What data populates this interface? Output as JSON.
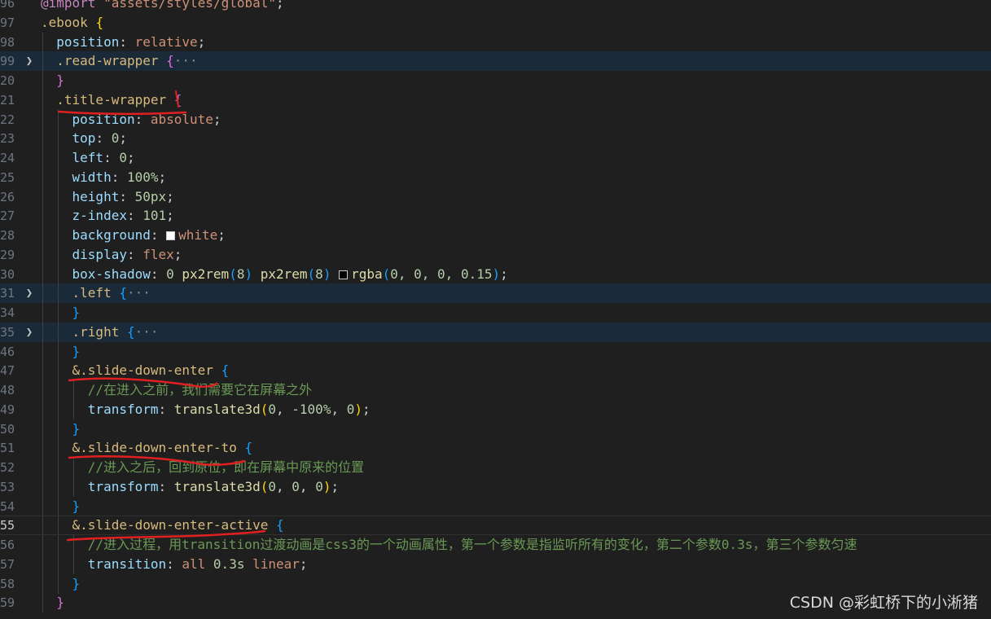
{
  "colors": {
    "background": "#1f1f1f",
    "selector": "#d7ba7d",
    "property": "#9cdcfe",
    "value": "#ce9178",
    "number": "#b5cea8",
    "function": "#dcdcaa",
    "comment": "#6a9955",
    "annotation_underline": "#e02020"
  },
  "lines": [
    {
      "num": "96",
      "fold": "",
      "tokens": [
        {
          "t": "@import",
          "c": "kw"
        },
        {
          "t": " \"assets/styles/global\"",
          "c": "str"
        },
        {
          "t": ";",
          "c": "punc"
        }
      ]
    },
    {
      "num": "97",
      "fold": "",
      "tokens": [
        {
          "t": ".ebook ",
          "c": "sel"
        },
        {
          "t": "{",
          "c": "brace1"
        }
      ]
    },
    {
      "num": "98",
      "fold": "",
      "tokens": [
        {
          "t": "  position",
          "c": "prop"
        },
        {
          "t": ": ",
          "c": "punc"
        },
        {
          "t": "relative",
          "c": "val"
        },
        {
          "t": ";",
          "c": "punc"
        }
      ]
    },
    {
      "num": "99",
      "fold": ">",
      "tokens": [
        {
          "t": "  .read-wrapper ",
          "c": "sel"
        },
        {
          "t": "{",
          "c": "brace2"
        },
        {
          "t": "···",
          "c": "ellipsis"
        }
      ]
    },
    {
      "num": "20",
      "fold": "",
      "tokens": [
        {
          "t": "  ",
          "c": "punc"
        },
        {
          "t": "}",
          "c": "brace2"
        }
      ]
    },
    {
      "num": "21",
      "fold": "",
      "tokens": [
        {
          "t": "  .title-wrapper ",
          "c": "sel"
        },
        {
          "t": "{",
          "c": "brace2"
        }
      ]
    },
    {
      "num": "22",
      "fold": "",
      "tokens": [
        {
          "t": "    position",
          "c": "prop"
        },
        {
          "t": ": ",
          "c": "punc"
        },
        {
          "t": "absolute",
          "c": "val"
        },
        {
          "t": ";",
          "c": "punc"
        }
      ]
    },
    {
      "num": "23",
      "fold": "",
      "tokens": [
        {
          "t": "    top",
          "c": "prop"
        },
        {
          "t": ": ",
          "c": "punc"
        },
        {
          "t": "0",
          "c": "num"
        },
        {
          "t": ";",
          "c": "punc"
        }
      ]
    },
    {
      "num": "24",
      "fold": "",
      "tokens": [
        {
          "t": "    left",
          "c": "prop"
        },
        {
          "t": ": ",
          "c": "punc"
        },
        {
          "t": "0",
          "c": "num"
        },
        {
          "t": ";",
          "c": "punc"
        }
      ]
    },
    {
      "num": "25",
      "fold": "",
      "tokens": [
        {
          "t": "    width",
          "c": "prop"
        },
        {
          "t": ": ",
          "c": "punc"
        },
        {
          "t": "100%",
          "c": "num"
        },
        {
          "t": ";",
          "c": "punc"
        }
      ]
    },
    {
      "num": "26",
      "fold": "",
      "tokens": [
        {
          "t": "    height",
          "c": "prop"
        },
        {
          "t": ": ",
          "c": "punc"
        },
        {
          "t": "50px",
          "c": "num"
        },
        {
          "t": ";",
          "c": "punc"
        }
      ]
    },
    {
      "num": "27",
      "fold": "",
      "tokens": [
        {
          "t": "    z-index",
          "c": "prop"
        },
        {
          "t": ": ",
          "c": "punc"
        },
        {
          "t": "101",
          "c": "num"
        },
        {
          "t": ";",
          "c": "punc"
        }
      ]
    },
    {
      "num": "28",
      "fold": "",
      "tokens": [
        {
          "t": "    background",
          "c": "prop"
        },
        {
          "t": ": ",
          "c": "punc"
        },
        {
          "t": "",
          "c": "swatch-white"
        },
        {
          "t": "white",
          "c": "val"
        },
        {
          "t": ";",
          "c": "punc"
        }
      ]
    },
    {
      "num": "29",
      "fold": "",
      "tokens": [
        {
          "t": "    display",
          "c": "prop"
        },
        {
          "t": ": ",
          "c": "punc"
        },
        {
          "t": "flex",
          "c": "val"
        },
        {
          "t": ";",
          "c": "punc"
        }
      ]
    },
    {
      "num": "30",
      "fold": "",
      "tokens": [
        {
          "t": "    box-shadow",
          "c": "prop"
        },
        {
          "t": ": ",
          "c": "punc"
        },
        {
          "t": "0 ",
          "c": "num"
        },
        {
          "t": "px2rem",
          "c": "fn"
        },
        {
          "t": "(",
          "c": "brace3"
        },
        {
          "t": "8",
          "c": "num"
        },
        {
          "t": ") ",
          "c": "brace3"
        },
        {
          "t": "px2rem",
          "c": "fn"
        },
        {
          "t": "(",
          "c": "brace3"
        },
        {
          "t": "8",
          "c": "num"
        },
        {
          "t": ") ",
          "c": "brace3"
        },
        {
          "t": "",
          "c": "swatch-dark"
        },
        {
          "t": "rgba",
          "c": "fn"
        },
        {
          "t": "(",
          "c": "brace3"
        },
        {
          "t": "0, 0, 0, 0.15",
          "c": "num"
        },
        {
          "t": ")",
          "c": "brace3"
        },
        {
          "t": ";",
          "c": "punc"
        }
      ]
    },
    {
      "num": "31",
      "fold": ">",
      "tokens": [
        {
          "t": "    .left ",
          "c": "sel"
        },
        {
          "t": "{",
          "c": "brace3"
        },
        {
          "t": "···",
          "c": "ellipsis"
        }
      ]
    },
    {
      "num": "34",
      "fold": "",
      "tokens": [
        {
          "t": "    ",
          "c": "punc"
        },
        {
          "t": "}",
          "c": "brace3"
        }
      ]
    },
    {
      "num": "35",
      "fold": ">",
      "tokens": [
        {
          "t": "    .right ",
          "c": "sel"
        },
        {
          "t": "{",
          "c": "brace3"
        },
        {
          "t": "···",
          "c": "ellipsis"
        }
      ]
    },
    {
      "num": "46",
      "fold": "",
      "tokens": [
        {
          "t": "    ",
          "c": "punc"
        },
        {
          "t": "}",
          "c": "brace3"
        }
      ]
    },
    {
      "num": "47",
      "fold": "",
      "tokens": [
        {
          "t": "    &.slide-down-enter ",
          "c": "sel"
        },
        {
          "t": "{",
          "c": "brace3"
        }
      ]
    },
    {
      "num": "48",
      "fold": "",
      "tokens": [
        {
          "t": "      //在进入之前，我们需要它在屏幕之外",
          "c": "cmt"
        }
      ]
    },
    {
      "num": "49",
      "fold": "",
      "tokens": [
        {
          "t": "      transform",
          "c": "prop"
        },
        {
          "t": ": ",
          "c": "punc"
        },
        {
          "t": "translate3d",
          "c": "fn"
        },
        {
          "t": "(",
          "c": "brace1"
        },
        {
          "t": "0",
          "c": "num"
        },
        {
          "t": ", ",
          "c": "punc"
        },
        {
          "t": "-100%",
          "c": "num"
        },
        {
          "t": ", ",
          "c": "punc"
        },
        {
          "t": "0",
          "c": "num"
        },
        {
          "t": ")",
          "c": "brace1"
        },
        {
          "t": ";",
          "c": "punc"
        }
      ]
    },
    {
      "num": "50",
      "fold": "",
      "tokens": [
        {
          "t": "    ",
          "c": "punc"
        },
        {
          "t": "}",
          "c": "brace3"
        }
      ]
    },
    {
      "num": "51",
      "fold": "",
      "tokens": [
        {
          "t": "    &.slide-down-enter-to ",
          "c": "sel"
        },
        {
          "t": "{",
          "c": "brace3"
        }
      ]
    },
    {
      "num": "52",
      "fold": "",
      "tokens": [
        {
          "t": "      //进入之后，回到原位，即在屏幕中原来的位置",
          "c": "cmt"
        }
      ]
    },
    {
      "num": "53",
      "fold": "",
      "tokens": [
        {
          "t": "      transform",
          "c": "prop"
        },
        {
          "t": ": ",
          "c": "punc"
        },
        {
          "t": "translate3d",
          "c": "fn"
        },
        {
          "t": "(",
          "c": "brace1"
        },
        {
          "t": "0",
          "c": "num"
        },
        {
          "t": ", ",
          "c": "punc"
        },
        {
          "t": "0",
          "c": "num"
        },
        {
          "t": ", ",
          "c": "punc"
        },
        {
          "t": "0",
          "c": "num"
        },
        {
          "t": ")",
          "c": "brace1"
        },
        {
          "t": ";",
          "c": "punc"
        }
      ]
    },
    {
      "num": "54",
      "fold": "",
      "tokens": [
        {
          "t": "    ",
          "c": "punc"
        },
        {
          "t": "}",
          "c": "brace3"
        }
      ]
    },
    {
      "num": "55",
      "fold": "",
      "tokens": [
        {
          "t": "    &.slide-down-enter-active ",
          "c": "sel"
        },
        {
          "t": "{",
          "c": "brace3"
        }
      ]
    },
    {
      "num": "56",
      "fold": "",
      "tokens": [
        {
          "t": "      //进入过程，用transition过渡动画是css3的一个动画属性，第一个参数是指监听所有的变化，第二个参数0.3s，第三个参数匀速",
          "c": "cmt"
        }
      ]
    },
    {
      "num": "57",
      "fold": "",
      "tokens": [
        {
          "t": "      transition",
          "c": "prop"
        },
        {
          "t": ": ",
          "c": "punc"
        },
        {
          "t": "all ",
          "c": "val"
        },
        {
          "t": "0.3s ",
          "c": "num"
        },
        {
          "t": "linear",
          "c": "val"
        },
        {
          "t": ";",
          "c": "punc"
        }
      ]
    },
    {
      "num": "58",
      "fold": "",
      "tokens": [
        {
          "t": "    ",
          "c": "punc"
        },
        {
          "t": "}",
          "c": "brace3"
        }
      ]
    },
    {
      "num": "59",
      "fold": "",
      "tokens": [
        {
          "t": "  ",
          "c": "punc"
        },
        {
          "t": "}",
          "c": "brace2"
        }
      ]
    }
  ],
  "watermark": "CSDN @彩虹桥下的小淅猪"
}
